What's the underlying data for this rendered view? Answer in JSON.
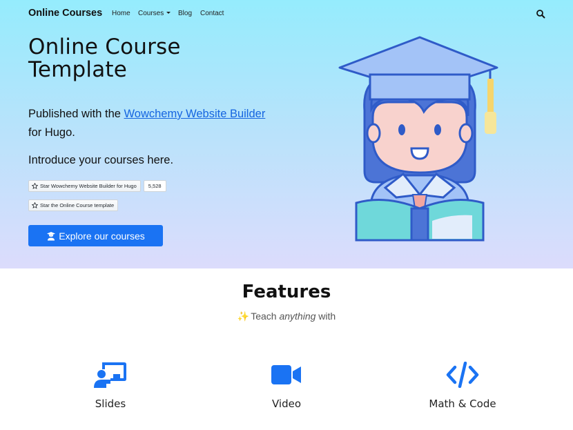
{
  "navbar": {
    "brand": "Online Courses",
    "links": [
      "Home",
      "Courses",
      "Blog",
      "Contact"
    ]
  },
  "hero": {
    "title_line1": "Online Course",
    "title_line2": "Template",
    "published_prefix": "Published with the ",
    "published_link": "Wowchemy Website Builder",
    "published_suffix": "for Hugo.",
    "introduce": "Introduce your courses here.",
    "star_wowchemy": "Star Wowchemy Website Builder for Hugo",
    "star_count": "5,528",
    "star_template": "Star the Online Course template",
    "cta": "Explore our courses"
  },
  "features": {
    "title": "Features",
    "subtitle_prefix": "Teach ",
    "subtitle_em": "anything",
    "subtitle_suffix": " with",
    "sparkle": "✨",
    "items": [
      {
        "label": "Slides",
        "icon": "chalkboard-teacher-icon"
      },
      {
        "label": "Video",
        "icon": "video-camera-icon"
      },
      {
        "label": "Math & Code",
        "icon": "code-icon"
      }
    ]
  },
  "colors": {
    "accent": "#1a73f3",
    "link": "#1565e0",
    "hero_top": "#95ecfd",
    "hero_bottom": "#dcdcfc"
  }
}
